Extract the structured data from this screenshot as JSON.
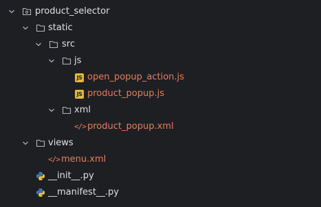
{
  "tree": {
    "root": {
      "label": "product_selector",
      "icon": "module-folder-icon"
    },
    "static": {
      "label": "static",
      "icon": "folder-icon"
    },
    "src": {
      "label": "src",
      "icon": "folder-icon"
    },
    "js": {
      "label": "js",
      "icon": "folder-icon"
    },
    "js_files": [
      {
        "label": "open_popup_action.js",
        "icon": "javascript-file-icon",
        "badge": "JS"
      },
      {
        "label": "product_popup.js",
        "icon": "javascript-file-icon",
        "badge": "JS"
      }
    ],
    "xml": {
      "label": "xml",
      "icon": "folder-icon"
    },
    "xml_files": [
      {
        "label": "product_popup.xml",
        "icon": "xml-file-icon",
        "glyph": "</>"
      }
    ],
    "views": {
      "label": "views",
      "icon": "folder-icon"
    },
    "views_files": [
      {
        "label": "menu.xml",
        "icon": "xml-file-icon",
        "glyph": "</>"
      }
    ],
    "py_files": [
      {
        "label": "__init__.py",
        "icon": "python-file-icon"
      },
      {
        "label": "__manifest__.py",
        "icon": "python-file-icon"
      }
    ]
  },
  "colors": {
    "background": "#1e1f22",
    "folder_text": "#dfe1e5",
    "modified_file_text": "#e67f5f",
    "js_badge": "#e5b93c",
    "python_blue": "#3f7dc1",
    "python_yellow": "#f2c94c"
  }
}
